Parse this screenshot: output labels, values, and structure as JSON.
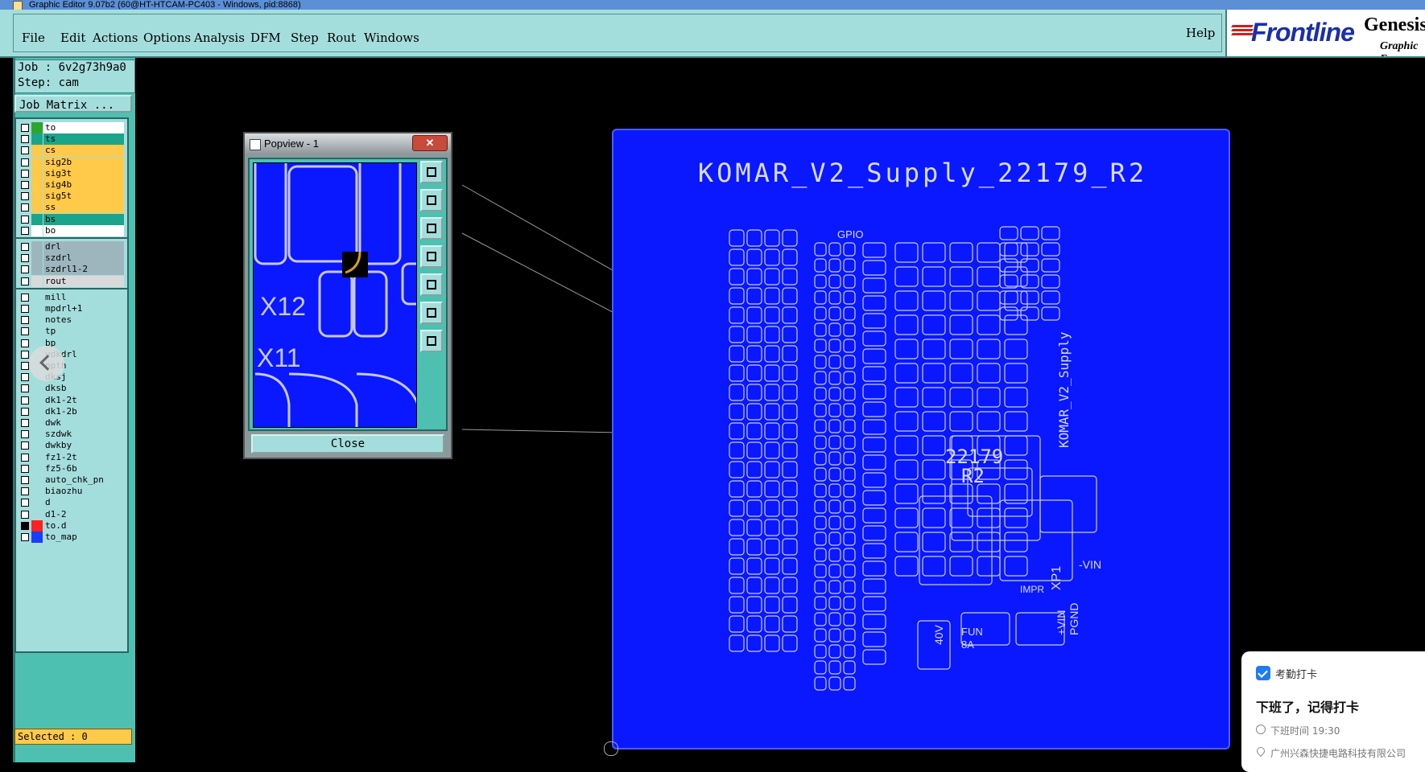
{
  "window": {
    "title": "Graphic Editor 9.07b2 (60@HT-HTCAM-PC403 - Windows, pid:8868)"
  },
  "menu": {
    "items": [
      {
        "label": "File"
      },
      {
        "label": "Edit"
      },
      {
        "label": "Actions"
      },
      {
        "label": "Options"
      },
      {
        "label": "Analysis"
      },
      {
        "label": "DFM"
      },
      {
        "label": "Step"
      },
      {
        "label": "Rout"
      },
      {
        "label": "Windows"
      }
    ],
    "help": "Help"
  },
  "brand": {
    "name": "Frontline",
    "product": "Genesis",
    "subtitle": "Graphic E"
  },
  "job": {
    "job_label": "Job : 6v2g73h9a0",
    "step_label": "Step: cam",
    "matrix_button": "Job Matrix ..."
  },
  "layers": [
    {
      "name": "to",
      "color": "#ffffff",
      "swatch": "#2fa52f",
      "active": false
    },
    {
      "name": "ts",
      "color": "#1aa58a",
      "swatch": "#1aa58a",
      "active": false
    },
    {
      "name": "cs",
      "color": "#ffc94a",
      "swatch": "#ffc94a",
      "active": false
    },
    {
      "name": "sig2b",
      "color": "#ffc94a",
      "swatch": "#ffc94a",
      "active": false
    },
    {
      "name": "sig3t",
      "color": "#ffc94a",
      "swatch": "#ffc94a",
      "active": false
    },
    {
      "name": "sig4b",
      "color": "#ffc94a",
      "swatch": "#ffc94a",
      "active": false
    },
    {
      "name": "sig5t",
      "color": "#ffc94a",
      "swatch": "#ffc94a",
      "active": false
    },
    {
      "name": "ss",
      "color": "#ffc94a",
      "swatch": "#ffc94a",
      "active": false
    },
    {
      "name": "bs",
      "color": "#1aa58a",
      "swatch": "#1aa58a",
      "active": false
    },
    {
      "name": "bo",
      "color": "#ffffff",
      "swatch": "#ffffff",
      "active": false
    },
    {
      "name": "drl",
      "color": "#9db6bd",
      "swatch": "#9db6bd",
      "active": false
    },
    {
      "name": "szdrl",
      "color": "#9db6bd",
      "swatch": "#9db6bd",
      "active": false
    },
    {
      "name": "szdrl1-2",
      "color": "#9db6bd",
      "swatch": "#9db6bd",
      "active": false
    },
    {
      "name": "rout",
      "color": "#d9d9d9",
      "swatch": "#d9d9d9",
      "active": false
    },
    {
      "name": "mill",
      "color": "#a4dedc",
      "swatch": "#a4dedc",
      "active": false
    },
    {
      "name": "mpdrl+1",
      "color": "#a4dedc",
      "swatch": "#a4dedc",
      "active": false
    },
    {
      "name": "notes",
      "color": "#a4dedc",
      "swatch": "#a4dedc",
      "active": false
    },
    {
      "name": "tp",
      "color": "#a4dedc",
      "swatch": "#a4dedc",
      "active": false
    },
    {
      "name": "bp",
      "color": "#a4dedc",
      "swatch": "#a4dedc",
      "active": false
    },
    {
      "name": "ydkdrl",
      "color": "#a4dedc",
      "swatch": "#a4dedc",
      "active": false
    },
    {
      "name": "npth",
      "color": "#a4dedc",
      "swatch": "#a4dedc",
      "active": false
    },
    {
      "name": "dksj",
      "color": "#a4dedc",
      "swatch": "#a4dedc",
      "active": false
    },
    {
      "name": "dksb",
      "color": "#a4dedc",
      "swatch": "#a4dedc",
      "active": false
    },
    {
      "name": "dk1-2t",
      "color": "#a4dedc",
      "swatch": "#a4dedc",
      "active": false
    },
    {
      "name": "dk1-2b",
      "color": "#a4dedc",
      "swatch": "#a4dedc",
      "active": false
    },
    {
      "name": "dwk",
      "color": "#a4dedc",
      "swatch": "#a4dedc",
      "active": false
    },
    {
      "name": "szdwk",
      "color": "#a4dedc",
      "swatch": "#a4dedc",
      "active": false
    },
    {
      "name": "dwkby",
      "color": "#a4dedc",
      "swatch": "#a4dedc",
      "active": false
    },
    {
      "name": "fz1-2t",
      "color": "#a4dedc",
      "swatch": "#a4dedc",
      "active": false
    },
    {
      "name": "fz5-6b",
      "color": "#a4dedc",
      "swatch": "#a4dedc",
      "active": false
    },
    {
      "name": "auto_chk_pn",
      "color": "#a4dedc",
      "swatch": "#a4dedc",
      "active": false
    },
    {
      "name": "biaozhu",
      "color": "#a4dedc",
      "swatch": "#a4dedc",
      "active": false
    },
    {
      "name": "d",
      "color": "#a4dedc",
      "swatch": "#a4dedc",
      "active": false
    },
    {
      "name": "d1-2",
      "color": "#a4dedc",
      "swatch": "#a4dedc",
      "active": false
    },
    {
      "name": "to.d",
      "color": "#a4dedc",
      "swatch": "#ff2020",
      "active": true
    },
    {
      "name": "to_map",
      "color": "#a4dedc",
      "swatch": "#1a3cff",
      "active": false
    }
  ],
  "status": {
    "selected": "Selected : 0"
  },
  "popview": {
    "title": "Popview - 1",
    "close_label": "Close",
    "labels": [
      "X12",
      "X11"
    ]
  },
  "board": {
    "title": "KOMAR_V2_Supply_22179_R2",
    "texts": [
      "GPIO",
      "22179",
      "R2",
      "KOMAR_V2_Supply",
      "IMPR",
      "XP1",
      "-VIN",
      "+VIN",
      "PGND",
      "40V",
      "FUN",
      "8A"
    ]
  },
  "toast": {
    "app": "考勤打卡",
    "message": "下班了，记得打卡",
    "time": "下班时间 19:30",
    "location": "广州兴森快捷电路科技有限公司"
  }
}
